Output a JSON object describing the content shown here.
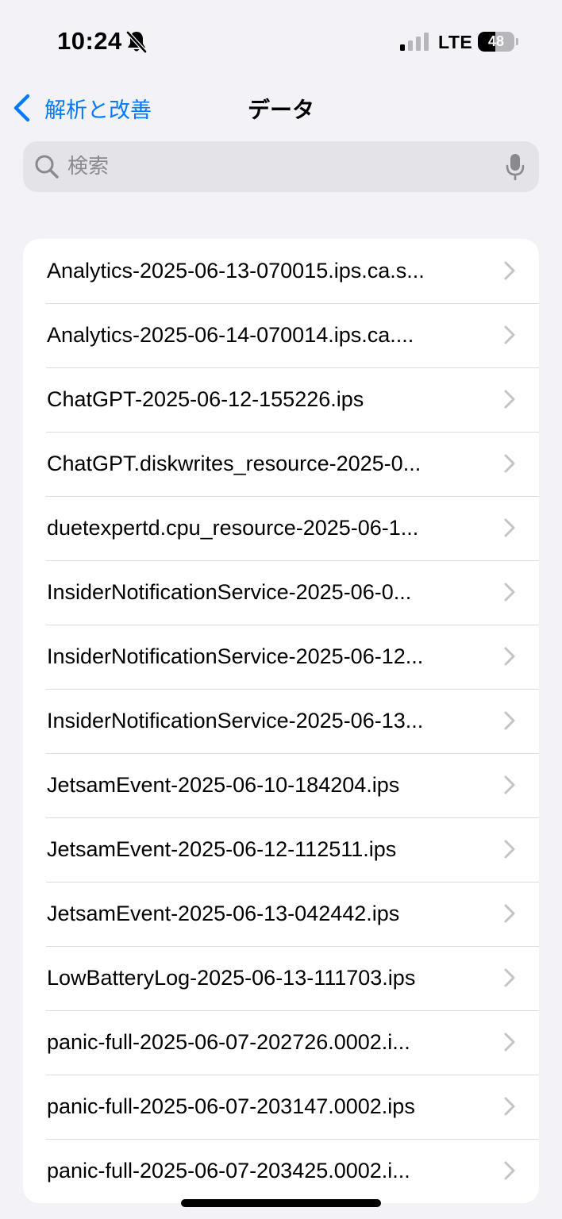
{
  "status_bar": {
    "time": "10:24",
    "network": "LTE",
    "battery_level": "48",
    "battery_fraction": 0.48
  },
  "nav": {
    "back_label": "解析と改善",
    "title": "データ"
  },
  "search": {
    "placeholder": "検索",
    "value": ""
  },
  "colors": {
    "accent": "#007aff",
    "background": "#f2f2f7",
    "separator": "#dcdce0",
    "chevron": "#c4c4c7"
  },
  "icons": [
    "bell-slash-icon",
    "cellular-signal-icon",
    "battery-icon",
    "back-chevron-icon",
    "search-icon",
    "microphone-icon",
    "chevron-right-icon"
  ],
  "items": [
    "Analytics-2025-06-13-070015.ips.ca.s...",
    "Analytics-2025-06-14-070014.ips.ca....",
    "ChatGPT-2025-06-12-155226.ips",
    "ChatGPT.diskwrites_resource-2025-0...",
    "duetexpertd.cpu_resource-2025-06-1...",
    "InsiderNotificationService-2025-06-0...",
    "InsiderNotificationService-2025-06-12...",
    "InsiderNotificationService-2025-06-13...",
    "JetsamEvent-2025-06-10-184204.ips",
    "JetsamEvent-2025-06-12-112511.ips",
    "JetsamEvent-2025-06-13-042442.ips",
    "LowBatteryLog-2025-06-13-111703.ips",
    "panic-full-2025-06-07-202726.0002.i...",
    "panic-full-2025-06-07-203147.0002.ips",
    "panic-full-2025-06-07-203425.0002.i..."
  ]
}
